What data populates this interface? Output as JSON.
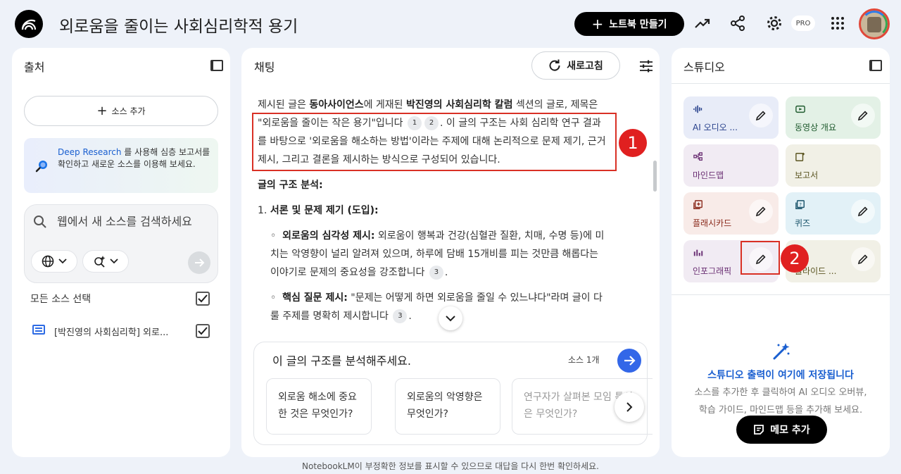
{
  "header": {
    "notebook_title": "외로움을 줄이는 사회심리학적 용기",
    "create_notebook_label": "노트북 만들기",
    "pro_badge": "PRO"
  },
  "sources_panel": {
    "title": "출처",
    "add_source_label": "소스 추가",
    "deep_research": {
      "link": "Deep Research",
      "text": " 를 사용해 심층 보고서를 확인하고 새로운 소스를 이용해 보세요."
    },
    "search_placeholder": "웹에서 새 소스를 검색하세요",
    "select_all_label": "모든 소스 선택",
    "items": [
      {
        "label": "[박진영의 사회심리학] 외로...",
        "checked": true
      }
    ]
  },
  "chat_panel": {
    "title": "채팅",
    "refresh_label": "새로고침",
    "intro_1": "제시된 글은 ",
    "intro_b1": "동아사이언스",
    "intro_2": "에 게재된 ",
    "intro_b2": "박진영의 사회심리학 칼럼",
    "intro_3": " 섹션의 글로, 제목은 \"외로움을 줄이는 작은 용기\"입니다",
    "intro_4": ". 이 글의 구조는 사회 심리학 연구 결과를 바탕으로 '외로움을 해소하는 방법'이라는 주제에 대해 논리적으로 문제 제기, 근거 제시, 그리고 결론을 제시하는 방식으로 구성되어 있습니다.",
    "structure_heading": "글의 구조 분석:",
    "section_1_prefix": "1. ",
    "section_1_title": "서론 및 문제 제기 (도입):",
    "bullet_1_title": "외로움의 심각성 제시:",
    "bullet_1_text": " 외로움이 행복과 건강(심혈관 질환, 치매, 수명 등)에 미치는 악영향이 널리 알려져 있으며, 하루에 담배 15개비를 피는 것만큼 해롭다는 이야기로 문제의 중요성을 강조합니다",
    "bullet_2_title": "핵심 질문 제시:",
    "bullet_2_text": " \"문제는 어떻게 하면 외로움을 줄일 수 있느냐다\"라며 글이 다룰 주제를 명확히 제시합니다",
    "citations": [
      "1",
      "2",
      "3",
      "3"
    ],
    "composer_text": "이 글의 구조를 분석해주세요.",
    "source_count": "소스 1개",
    "suggestions": [
      "외로움 해소에 중요한 것은 무엇인가?",
      "외로움의 악영향은 무엇인가?",
      "연구자가 살펴본 모임 특성은 무엇인가?"
    ]
  },
  "studio_panel": {
    "title": "스튜디오",
    "tiles": [
      {
        "label": "AI 오디오 ...",
        "bg": "#e8ecf8",
        "fg": "#27408b"
      },
      {
        "label": "동영상 개요",
        "bg": "#e3f1e6",
        "fg": "#1e5a2d"
      },
      {
        "label": "마인드맵",
        "bg": "#f1ebf3",
        "fg": "#6a2f73"
      },
      {
        "label": "보고서",
        "bg": "#f1f0e6",
        "fg": "#5a5420"
      },
      {
        "label": "플래시카드",
        "bg": "#f8ebe8",
        "fg": "#8a2a1c"
      },
      {
        "label": "퀴즈",
        "bg": "#e2f1f7",
        "fg": "#19536a"
      },
      {
        "label": "인포그래픽",
        "bg": "#f1ebf3",
        "fg": "#6a2f73"
      },
      {
        "label": "슬라이드 ...",
        "bg": "#f1f0e6",
        "fg": "#5a5420"
      }
    ],
    "empty_title": "스튜디오 출력이 여기에 저장됩니다",
    "empty_desc_1": "소스를 추가한 후 클릭하여 AI 오디오 오버뷰,",
    "empty_desc_2": "학습 가이드, 마인드맵 등을 추가해 보세요.",
    "add_memo_label": "메모 추가"
  },
  "annotations": [
    "1",
    "2"
  ],
  "footer": {
    "disclaimer": "NotebookLM이 부정확한 정보를 표시할 수 있으므로 대답을 다시 한번 확인하세요."
  }
}
